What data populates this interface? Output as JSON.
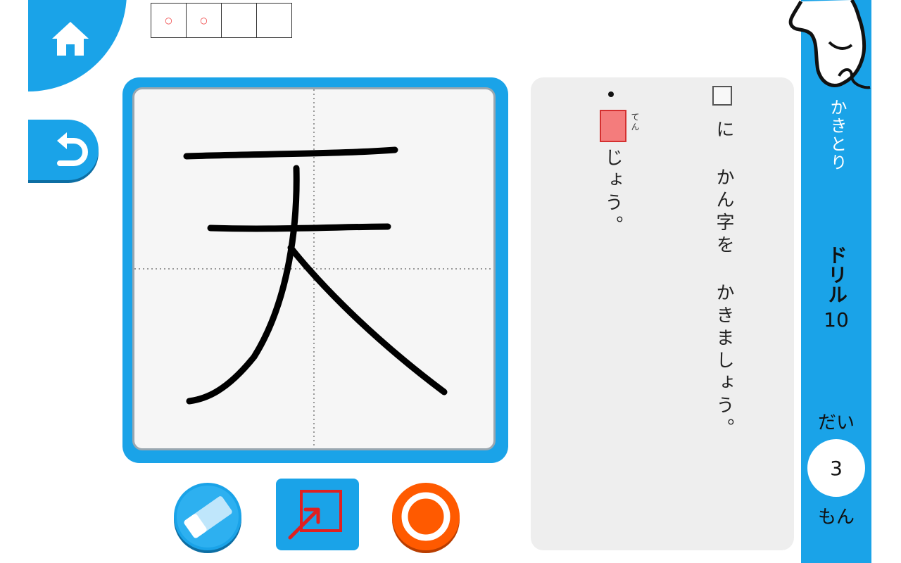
{
  "progress": {
    "cells": [
      "○",
      "○",
      "",
      ""
    ]
  },
  "canvas": {
    "character_strokes": "天"
  },
  "question": {
    "instruction_box": "□",
    "instruction": "に かん字を かきましょう。",
    "furigana": "てん",
    "sentence": "じょう。"
  },
  "sidebar": {
    "mode": "かきとり",
    "drill_label": "ドリル",
    "drill_number": "10",
    "question_prefix": "だい",
    "question_number": "3",
    "question_suffix": "もん"
  },
  "colors": {
    "accent": "#1aa3e8",
    "answer_box": "#f47c7c",
    "ok": "#ff5a00"
  },
  "icons": [
    "home-icon",
    "undo-icon",
    "eraser-icon",
    "fit-icon",
    "ok-circle-icon",
    "pointer-hand-icon"
  ]
}
